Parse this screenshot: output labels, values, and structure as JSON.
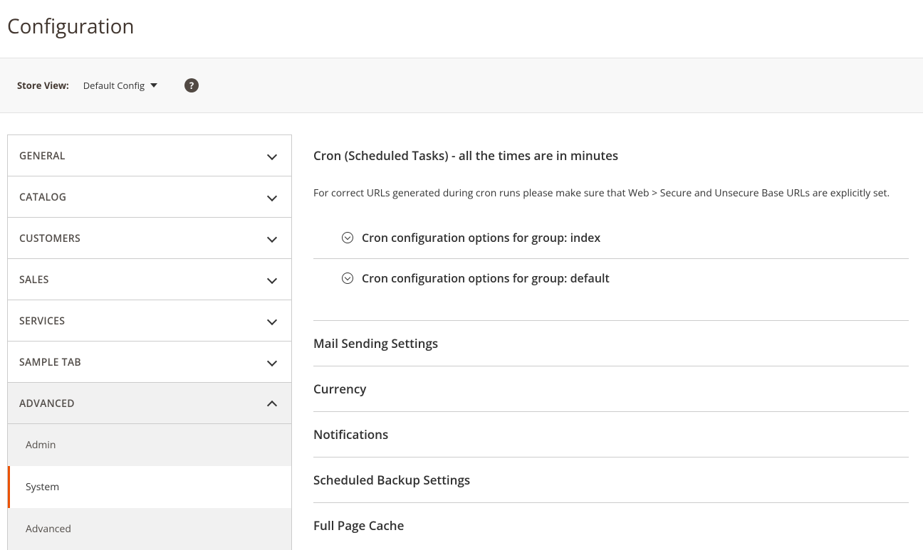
{
  "page": {
    "title": "Configuration"
  },
  "store_switcher": {
    "label": "Store View:",
    "value": "Default Config"
  },
  "sidebar": {
    "tabs": [
      {
        "label": "GENERAL",
        "expanded": false
      },
      {
        "label": "CATALOG",
        "expanded": false
      },
      {
        "label": "CUSTOMERS",
        "expanded": false
      },
      {
        "label": "SALES",
        "expanded": false
      },
      {
        "label": "SERVICES",
        "expanded": false
      },
      {
        "label": "SAMPLE TAB",
        "expanded": false
      },
      {
        "label": "ADVANCED",
        "expanded": true
      }
    ],
    "advanced_subtabs": [
      {
        "label": "Admin",
        "active": false
      },
      {
        "label": "System",
        "active": true
      },
      {
        "label": "Advanced",
        "active": false
      }
    ]
  },
  "main": {
    "cron": {
      "title": "Cron (Scheduled Tasks) - all the times are in minutes",
      "note": "For correct URLs generated during cron runs please make sure that Web > Secure and Unsecure Base URLs are explicitly set.",
      "groups": [
        {
          "label": "Cron configuration options for group: index"
        },
        {
          "label": "Cron configuration options for group: default"
        }
      ]
    },
    "sections": [
      {
        "label": "Mail Sending Settings"
      },
      {
        "label": "Currency"
      },
      {
        "label": "Notifications"
      },
      {
        "label": "Scheduled Backup Settings"
      },
      {
        "label": "Full Page Cache"
      }
    ]
  }
}
